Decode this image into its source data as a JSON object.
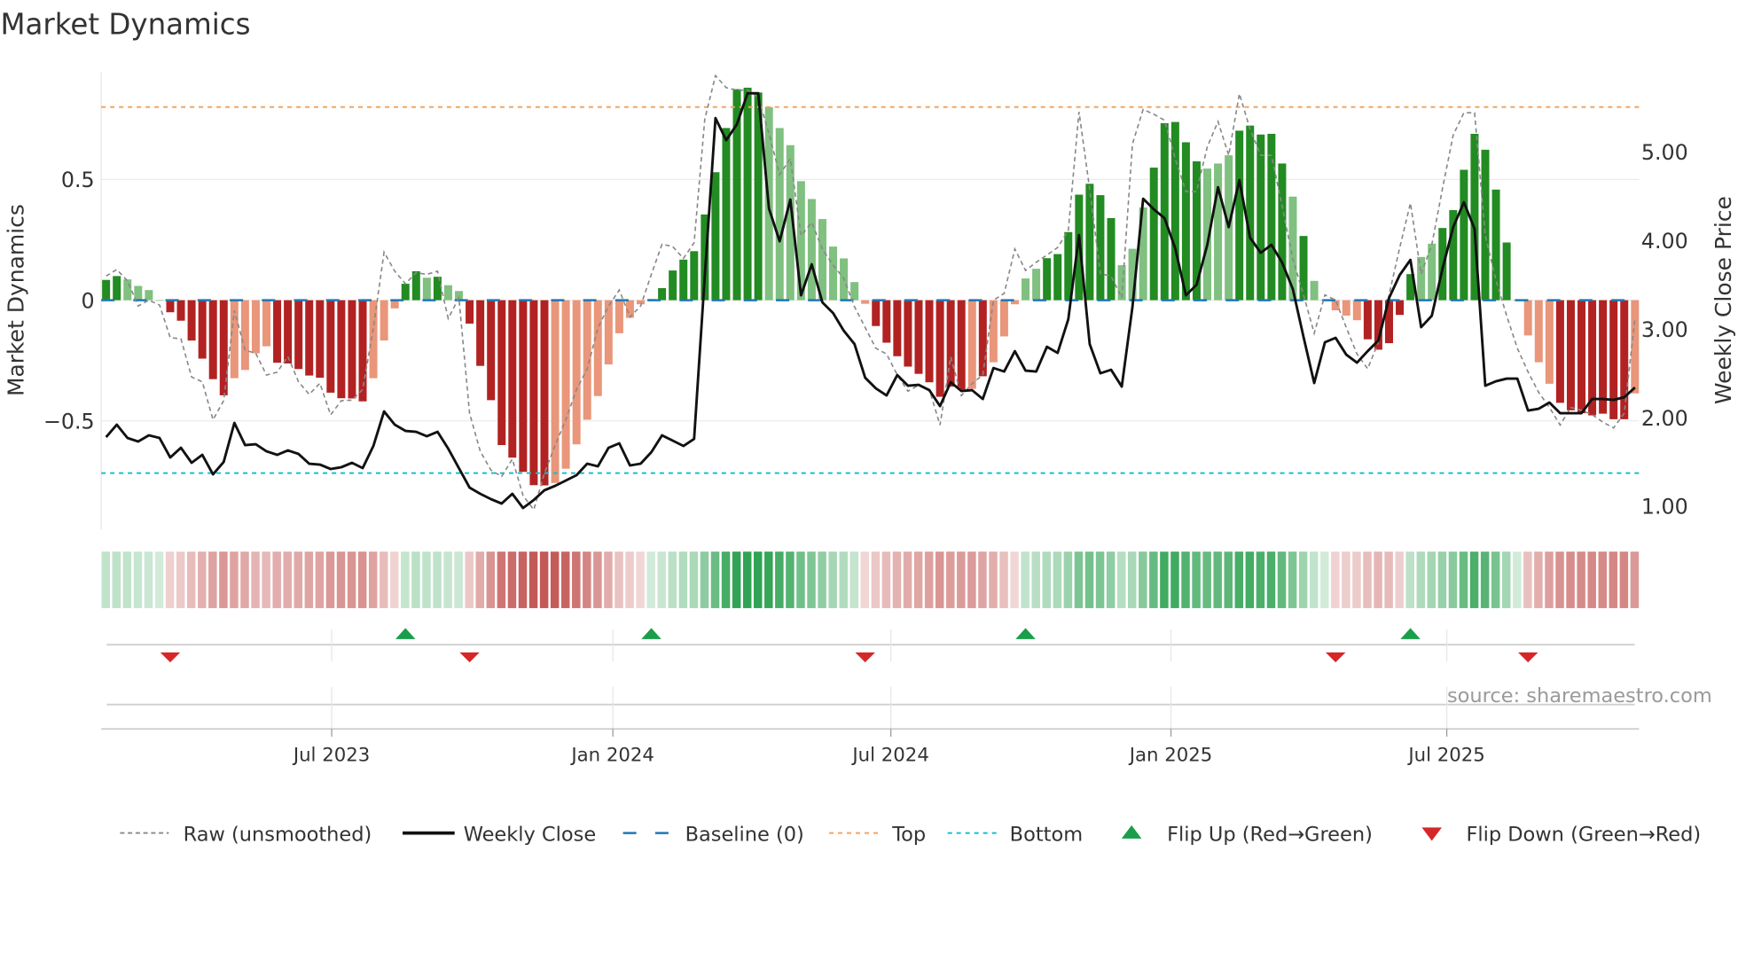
{
  "title": "Market Dynamics",
  "source": "source: sharemaestro.com",
  "colors": {
    "dark_green": "#228b22",
    "light_green": "#80c080",
    "dark_red": "#b22222",
    "light_red": "#e9967a",
    "raw": "#888888",
    "close": "#111111",
    "baseline": "#1f77b4",
    "top": "#f4a460",
    "bottom": "#17becf",
    "flip_up": "#1a9e4a",
    "flip_down": "#d62728",
    "heat_green": "#31a354",
    "heat_red": "#c0504d"
  },
  "chart_data": {
    "type": "bar",
    "title": "Market Dynamics",
    "ylabel": "Market Dynamics",
    "y2label": "Weekly Close Price",
    "ylim": [
      -0.95,
      0.95
    ],
    "y2lim": [
      0.85,
      5.85
    ],
    "yticks": [
      {
        "v": 0.5,
        "label": "0.5"
      },
      {
        "v": 0,
        "label": "0"
      },
      {
        "v": -0.5,
        "label": "−0.5"
      }
    ],
    "y2ticks": [
      {
        "v": 5,
        "label": "5.00"
      },
      {
        "v": 4,
        "label": "4.00"
      },
      {
        "v": 3,
        "label": "3.00"
      },
      {
        "v": 2,
        "label": "2.00"
      },
      {
        "v": 1,
        "label": "1.00"
      }
    ],
    "xticks": [
      {
        "week": 21.1,
        "label": "Jul 2023"
      },
      {
        "week": 47.4,
        "label": "Jan 2024"
      },
      {
        "week": 73.4,
        "label": "Jul 2024"
      },
      {
        "week": 99.6,
        "label": "Jan 2025"
      },
      {
        "week": 125.4,
        "label": "Jul 2025"
      }
    ],
    "top_level": 0.8,
    "bottom_level": -0.716,
    "baseline": 0,
    "momentum": [
      0.084,
      0.1,
      0.086,
      0.059,
      0.042,
      0.0,
      -0.05,
      -0.085,
      -0.167,
      -0.242,
      -0.327,
      -0.394,
      -0.323,
      -0.289,
      -0.22,
      -0.191,
      -0.259,
      -0.262,
      -0.285,
      -0.312,
      -0.321,
      -0.383,
      -0.406,
      -0.407,
      -0.419,
      -0.323,
      -0.167,
      -0.034,
      0.068,
      0.12,
      0.093,
      0.097,
      0.062,
      0.038,
      -0.097,
      -0.272,
      -0.414,
      -0.6,
      -0.652,
      -0.711,
      -0.766,
      -0.767,
      -0.757,
      -0.698,
      -0.597,
      -0.495,
      -0.397,
      -0.266,
      -0.137,
      -0.073,
      -0.017,
      0.005,
      0.05,
      0.123,
      0.168,
      0.203,
      0.355,
      0.53,
      0.713,
      0.874,
      0.88,
      0.86,
      0.8,
      0.713,
      0.642,
      0.493,
      0.419,
      0.336,
      0.222,
      0.173,
      0.075,
      -0.015,
      -0.107,
      -0.176,
      -0.232,
      -0.275,
      -0.305,
      -0.34,
      -0.4,
      -0.358,
      -0.37,
      -0.367,
      -0.315,
      -0.257,
      -0.15,
      -0.017,
      0.09,
      0.13,
      0.174,
      0.191,
      0.282,
      0.437,
      0.482,
      0.435,
      0.34,
      0.145,
      0.213,
      0.384,
      0.549,
      0.733,
      0.738,
      0.654,
      0.575,
      0.545,
      0.566,
      0.6,
      0.702,
      0.723,
      0.686,
      0.689,
      0.566,
      0.429,
      0.266,
      0.08,
      0.0,
      -0.042,
      -0.064,
      -0.083,
      -0.162,
      -0.205,
      -0.178,
      -0.061,
      0.108,
      0.179,
      0.234,
      0.299,
      0.373,
      0.54,
      0.689,
      0.623,
      0.458,
      0.239,
      0.0,
      -0.146,
      -0.257,
      -0.346,
      -0.425,
      -0.456,
      -0.468,
      -0.477,
      -0.47,
      -0.493,
      -0.493,
      -0.386
    ],
    "shade": "ddllllddddddllllddddddddd lllddldllddddddddllllllllllddddddddddlllllllllldddddddddldllllldddddddllldddddllldddddldllllldddddllddddddd llllddddddd lddl",
    "raw": [
      0.1,
      0.127,
      0.08,
      -0.024,
      0.0,
      -0.02,
      -0.155,
      -0.16,
      -0.318,
      -0.338,
      -0.495,
      -0.416,
      -0.043,
      -0.207,
      -0.22,
      -0.31,
      -0.298,
      -0.233,
      -0.338,
      -0.39,
      -0.344,
      -0.475,
      -0.416,
      -0.414,
      -0.37,
      -0.115,
      0.199,
      0.12,
      0.068,
      0.114,
      0.107,
      0.12,
      -0.076,
      0.01,
      -0.469,
      -0.626,
      -0.704,
      -0.73,
      -0.658,
      -0.809,
      -0.868,
      -0.717,
      -0.6,
      -0.495,
      -0.37,
      -0.285,
      -0.115,
      -0.024,
      0.042,
      -0.07,
      -0.024,
      0.107,
      0.232,
      0.222,
      0.173,
      0.238,
      0.75,
      0.93,
      0.88,
      0.87,
      0.87,
      0.84,
      0.69,
      0.52,
      0.586,
      0.267,
      0.322,
      0.212,
      0.145,
      0.09,
      -0.027,
      -0.113,
      -0.199,
      -0.223,
      -0.309,
      -0.377,
      -0.352,
      -0.37,
      -0.517,
      -0.235,
      -0.395,
      -0.346,
      -0.309,
      0.0,
      0.028,
      0.212,
      0.123,
      0.157,
      0.187,
      0.218,
      0.29,
      0.78,
      0.46,
      0.11,
      0.1,
      0.01,
      0.647,
      0.79,
      0.77,
      0.745,
      0.586,
      0.45,
      0.45,
      0.635,
      0.74,
      0.6,
      0.855,
      0.708,
      0.6,
      0.6,
      0.39,
      0.17,
      0.022,
      -0.137,
      0.022,
      0.0,
      -0.113,
      -0.223,
      -0.284,
      -0.174,
      0.022,
      0.218,
      0.402,
      0.108,
      0.23,
      0.463,
      0.684,
      0.776,
      0.776,
      0.267,
      0.083,
      -0.064,
      -0.199,
      -0.297,
      -0.382,
      -0.444,
      -0.517,
      -0.444,
      -0.456,
      -0.474,
      -0.505,
      -0.529,
      -0.468,
      -0.076
    ],
    "close": [
      1.78,
      1.92,
      1.77,
      1.73,
      1.8,
      1.77,
      1.55,
      1.66,
      1.49,
      1.58,
      1.36,
      1.5,
      1.94,
      1.69,
      1.7,
      1.62,
      1.58,
      1.63,
      1.59,
      1.48,
      1.47,
      1.42,
      1.44,
      1.49,
      1.43,
      1.68,
      2.07,
      1.92,
      1.85,
      1.84,
      1.79,
      1.84,
      1.65,
      1.43,
      1.21,
      1.14,
      1.08,
      1.03,
      1.14,
      0.98,
      1.07,
      1.18,
      1.23,
      1.29,
      1.35,
      1.48,
      1.45,
      1.66,
      1.71,
      1.46,
      1.48,
      1.61,
      1.8,
      1.74,
      1.68,
      1.76,
      3.6,
      5.38,
      5.13,
      5.31,
      5.66,
      5.66,
      4.36,
      3.99,
      4.46,
      3.38,
      3.73,
      3.3,
      3.18,
      2.98,
      2.83,
      2.45,
      2.33,
      2.25,
      2.48,
      2.36,
      2.37,
      2.31,
      2.13,
      2.4,
      2.3,
      2.31,
      2.21,
      2.56,
      2.52,
      2.75,
      2.53,
      2.52,
      2.8,
      2.73,
      3.11,
      4.06,
      2.83,
      2.5,
      2.54,
      2.35,
      3.25,
      4.47,
      4.35,
      4.25,
      3.91,
      3.38,
      3.5,
      3.95,
      4.6,
      4.15,
      4.68,
      4.03,
      3.86,
      3.95,
      3.75,
      3.45,
      2.91,
      2.39,
      2.85,
      2.9,
      2.71,
      2.62,
      2.75,
      2.87,
      3.35,
      3.61,
      3.78,
      3.02,
      3.15,
      3.68,
      4.15,
      4.43,
      4.13,
      2.36,
      2.41,
      2.44,
      2.44,
      2.08,
      2.1,
      2.17,
      2.05,
      2.05,
      2.05,
      2.21,
      2.21,
      2.2,
      2.23,
      2.34
    ],
    "flips": [
      {
        "week": 7,
        "dir": "down"
      },
      {
        "week": 29,
        "dir": "up"
      },
      {
        "week": 35,
        "dir": "down"
      },
      {
        "week": 52,
        "dir": "up"
      },
      {
        "week": 72,
        "dir": "down"
      },
      {
        "week": 87,
        "dir": "up"
      },
      {
        "week": 116,
        "dir": "down"
      },
      {
        "week": 123,
        "dir": "up"
      },
      {
        "week": 134,
        "dir": "down"
      }
    ],
    "legend": {
      "placement": "bottom",
      "items": [
        "Raw (unsmoothed)",
        "Weekly Close",
        "Baseline (0)",
        "Top",
        "Bottom",
        "Flip Up (Red→Green)",
        "Flip Down (Green→Red)"
      ]
    }
  }
}
